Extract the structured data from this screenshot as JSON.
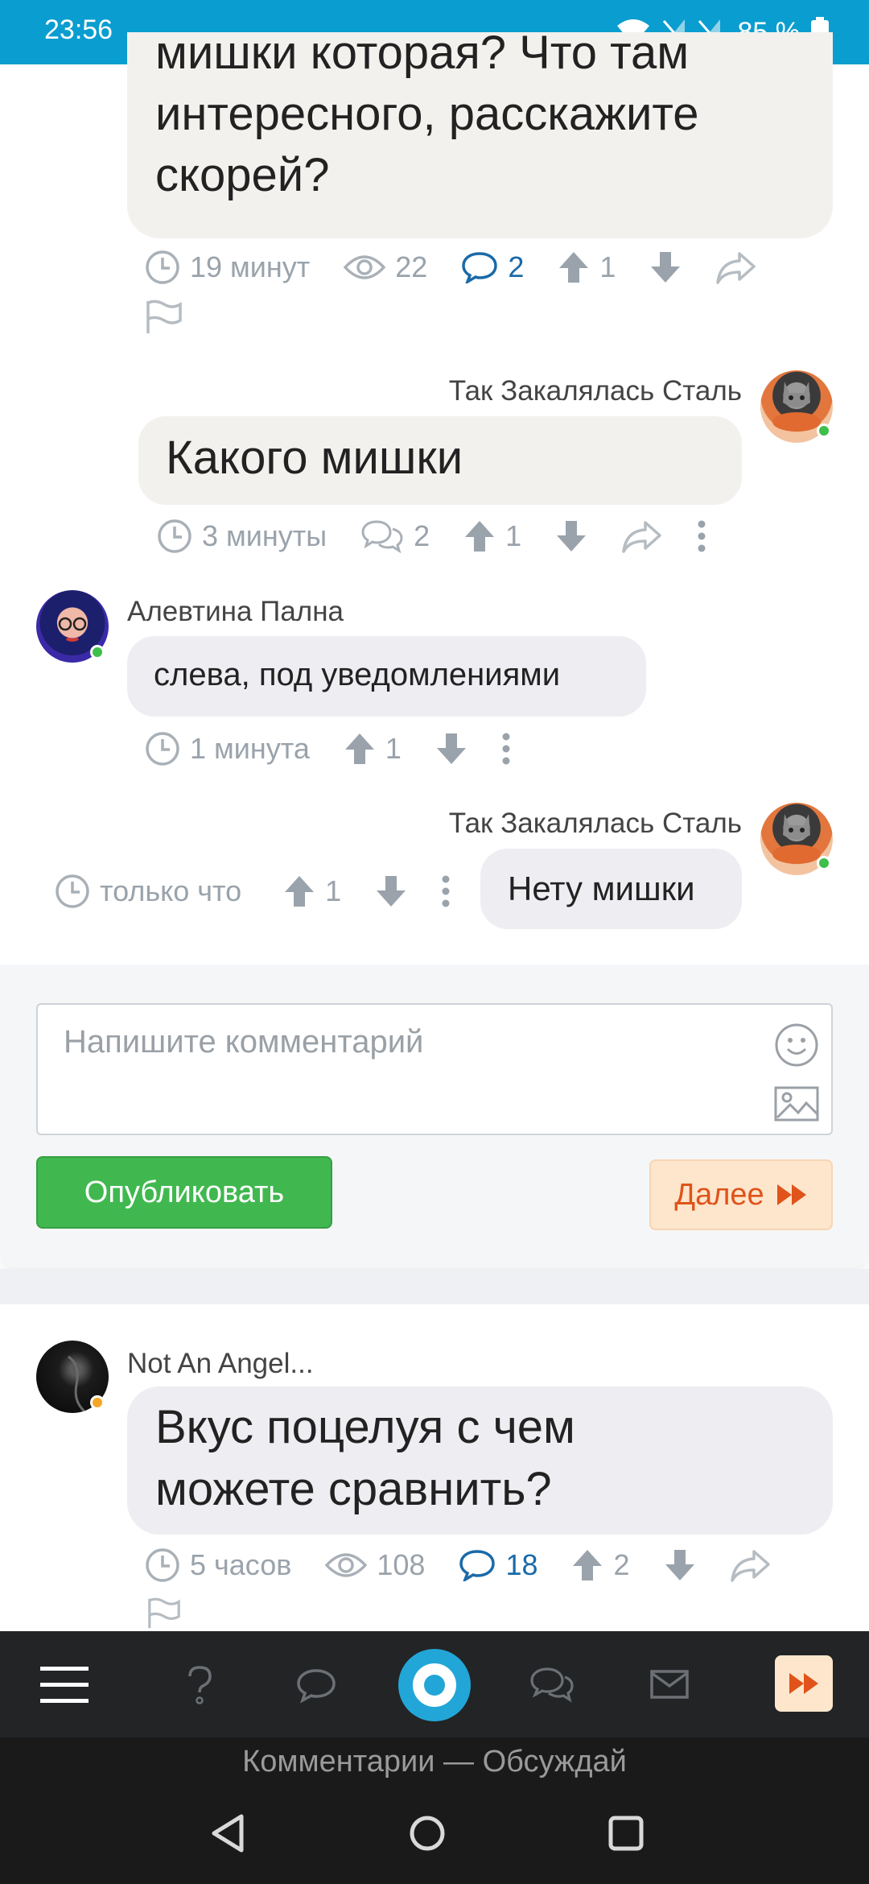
{
  "status_bar": {
    "time": "23:56",
    "battery": "85 %"
  },
  "posts": [
    {
      "text_lines": [
        "мишки которая? Что там",
        "интересного, расскажите",
        "скорей?"
      ],
      "meta": {
        "time": "19 минут",
        "views": "22",
        "comments": "2",
        "likes": "1"
      }
    },
    {
      "author": "Так Закалялась Сталь",
      "text": "Какого мишки",
      "meta": {
        "time": "3 минуты",
        "comments": "2",
        "likes": "1"
      }
    },
    {
      "author": "Алевтина Пална",
      "text": "слева, под уведомлениями",
      "meta": {
        "time": "1 минута",
        "likes": "1"
      }
    },
    {
      "author": "Так Закалялась Сталь",
      "text": "Нету мишки",
      "meta": {
        "time": "только что",
        "likes": "1"
      }
    }
  ],
  "composer": {
    "placeholder": "Напишите комментарий",
    "publish_label": "Опубликовать",
    "next_label": "Далее"
  },
  "next_post": {
    "author": "Not An Angel...",
    "text_lines": [
      "Вкус поцелуя с чем",
      "можете сравнить?"
    ],
    "meta": {
      "time": "5 часов",
      "views": "108",
      "comments": "18",
      "likes": "2"
    }
  },
  "bottom_caption": "Комментарии — Обсуждай",
  "colors": {
    "status_bar": "#0a9dcf",
    "link_blue": "#1a6aa8",
    "publish_green": "#40b84f",
    "next_orange": "#e0531a",
    "online_green": "#3dbf4a",
    "online_orange": "#f5a623"
  },
  "icons": [
    "clock-icon",
    "eye-icon",
    "comment-icon",
    "comments-icon",
    "arrow-up-icon",
    "arrow-down-icon",
    "share-icon",
    "flag-icon",
    "more-icon",
    "smiley-icon",
    "image-icon",
    "menu-icon",
    "question-icon",
    "chat-icon",
    "home-logo-icon",
    "discussions-icon",
    "mail-icon",
    "fast-forward-icon"
  ]
}
